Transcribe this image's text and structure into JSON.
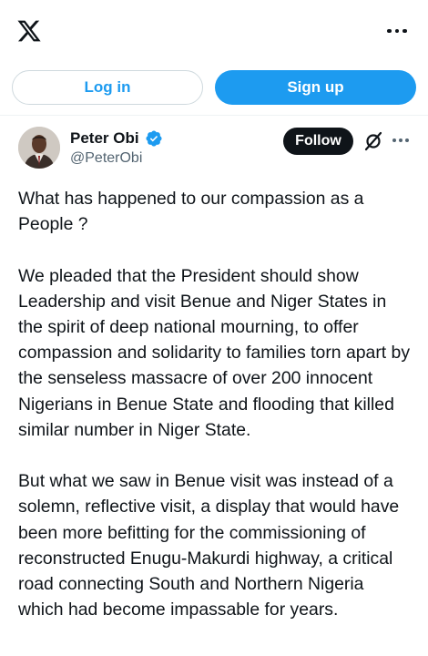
{
  "header": {
    "logo_icon": "x-logo-icon",
    "more_icon": "more-horizontal-icon"
  },
  "auth": {
    "login_label": "Log in",
    "signup_label": "Sign up"
  },
  "post": {
    "author_name": "Peter Obi",
    "handle": "@PeterObi",
    "verified": true,
    "follow_label": "Follow",
    "grok_icon": "grok-icon",
    "more_icon": "more-horizontal-icon",
    "paragraphs": [
      "What has happened to our compassion as a People ?",
      "We pleaded that the President should show Leadership and visit Benue and Niger States in the spirit of deep national mourning, to offer compassion and solidarity to families torn apart by the senseless massacre of over 200 innocent Nigerians in Benue State and flooding that killed similar number in Niger State.",
      "But what we saw in Benue visit was instead of a solemn, reflective visit, a display that would have been more befitting for the commissioning of reconstructed Enugu-Makurdi highway, a critical road connecting South and Northern Nigeria which had become impassable for years."
    ]
  },
  "colors": {
    "accent": "#1d9bf0",
    "text": "#0f1419",
    "secondary_text": "#536471",
    "border": "#cfd9de"
  }
}
